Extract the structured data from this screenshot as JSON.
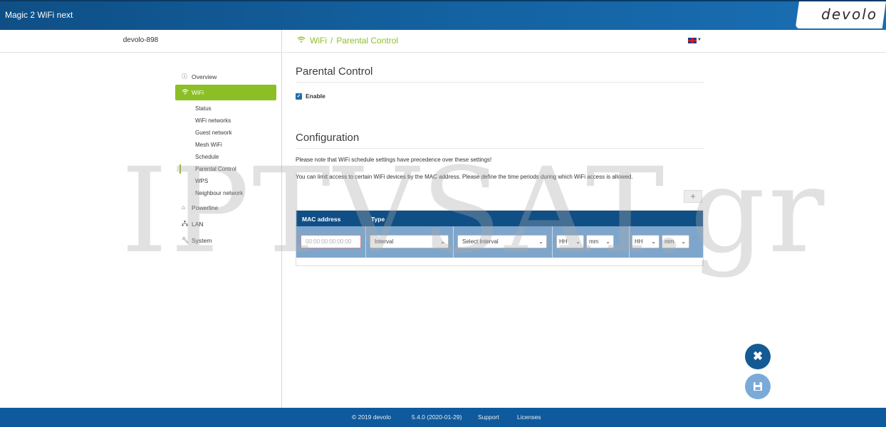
{
  "header": {
    "app_title": "Magic 2 WiFi next",
    "logo": "devolo"
  },
  "sidebar": {
    "device_name": "devolo-898",
    "items": [
      {
        "label": "Overview",
        "icon": "info-icon"
      },
      {
        "label": "WiFi",
        "icon": "wifi-icon",
        "active": true,
        "children": [
          "Status",
          "WiFi networks",
          "Guest network",
          "Mesh WiFi",
          "Schedule",
          "Parental Control",
          "WPS",
          "Neighbour network"
        ]
      },
      {
        "label": "Powerline",
        "icon": "home-icon"
      },
      {
        "label": "LAN",
        "icon": "lan-icon"
      },
      {
        "label": "System",
        "icon": "wrench-icon"
      }
    ],
    "current_sub": "Parental Control"
  },
  "breadcrumb": {
    "section": "WiFi",
    "separator": "/",
    "page": "Parental Control"
  },
  "language": {
    "icon": "uk-flag-icon"
  },
  "parental_control": {
    "title": "Parental Control",
    "enable_label": "Enable",
    "enabled": true
  },
  "configuration": {
    "title": "Configuration",
    "note1": "Please note that WiFi schedule settings have precedence over these settings!",
    "note2": "You can limit access to certain WiFi devices by the MAC address. Please define the time periods during which WiFi access is allowed.",
    "add_button": "+",
    "columns": [
      "MAC address",
      "Type"
    ],
    "row": {
      "mac_placeholder": "00:00:00:00:00:00",
      "type_value": "Interval",
      "interval_value": "Select Interval",
      "from_hh": "HH",
      "from_mm": "mm",
      "to_hh": "HH",
      "to_mm": "mm"
    }
  },
  "actions": {
    "cancel_icon": "close-icon",
    "save_icon": "save-icon"
  },
  "footer": {
    "copyright": "© 2019  devolo",
    "version": "5.4.0 (2020-01-29)",
    "support": "Support",
    "licenses": "Licenses"
  },
  "watermark": "IPTVSAT.gr",
  "colors": {
    "brand_blue": "#0f4f86",
    "accent_green": "#8cbf26"
  }
}
